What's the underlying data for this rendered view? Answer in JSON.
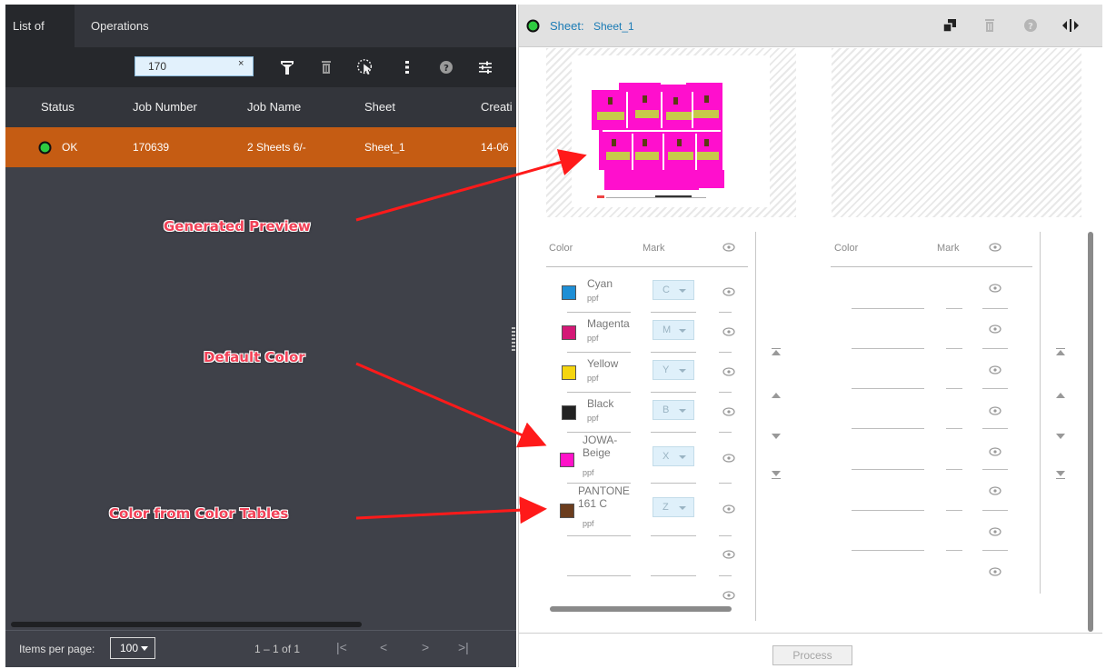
{
  "left": {
    "tabs": [
      "List of PPF",
      "Operations"
    ],
    "search": {
      "value": "170",
      "clear": "×"
    },
    "columns": [
      "Status",
      "Job Number",
      "Job Name",
      "Sheet",
      "Creati"
    ],
    "rows": [
      {
        "status": "OK",
        "job_number": "170639",
        "job_name": "2 Sheets 6/-",
        "sheet": "Sheet_1",
        "created": "14-06"
      }
    ],
    "footer": {
      "items_per_page_label": "Items per page:",
      "items_per_page_value": "100",
      "range": "1 – 1 of 1",
      "first": "|<",
      "prev": "<",
      "next": ">",
      "last": ">|"
    }
  },
  "right": {
    "header": {
      "sheet_label": "Sheet:",
      "sheet_name": "Sheet_1"
    },
    "left_table": {
      "col_color": "Color",
      "col_mark": "Mark",
      "rows": [
        {
          "name": "Cyan",
          "source": "ppf",
          "mark": "C",
          "swatch": "#1e8fd6"
        },
        {
          "name": "Magenta",
          "source": "ppf",
          "mark": "M",
          "swatch": "#d41876"
        },
        {
          "name": "Yellow",
          "source": "ppf",
          "mark": "Y",
          "swatch": "#f5d50f"
        },
        {
          "name": "Black",
          "source": "ppf",
          "mark": "B",
          "swatch": "#222222"
        },
        {
          "name": "JOWA-\nBeige",
          "source": "ppf",
          "mark": "X",
          "swatch": "#ff12c8"
        },
        {
          "name": "PANTONE\n161 C",
          "source": "ppf",
          "mark": "Z",
          "swatch": "#6b3d1e"
        }
      ]
    },
    "right_table": {
      "col_color": "Color",
      "col_mark": "Mark"
    },
    "process_label": "Process"
  },
  "annotations": {
    "preview": "Generated Preview",
    "default_color": "Default Color",
    "color_tables": "Color from Color Tables"
  },
  "colors": {
    "accent_row": "#c55c13",
    "status_ok": "#2ecc40",
    "annotation": "#f24157"
  }
}
